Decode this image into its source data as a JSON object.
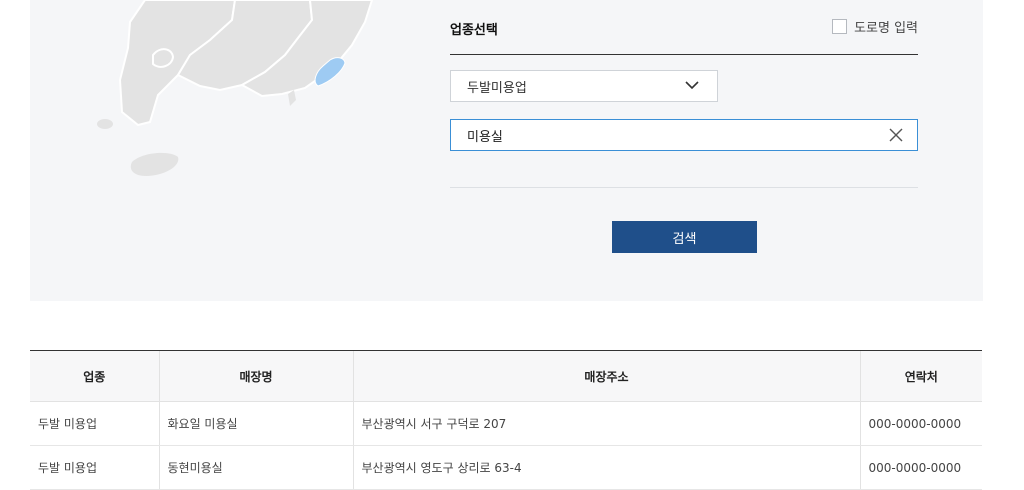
{
  "search": {
    "section_title": "업종선택",
    "road_name_label": "도로명 입력",
    "category_selected": "두발미용업",
    "keyword_value": "미용실",
    "search_button_label": "검색"
  },
  "map": {
    "highlight_color": "#9ecbf3",
    "region_color": "#e3e3e3"
  },
  "table": {
    "headers": [
      "업종",
      "매장명",
      "매장주소",
      "연락처"
    ],
    "rows": [
      [
        "두발 미용업",
        "화요일 미용실",
        "부산광역시 서구 구덕로 207",
        "000-0000-0000"
      ],
      [
        "두발 미용업",
        "동현미용실",
        "부산광역시 영도구 상리로 63-4",
        "000-0000-0000"
      ]
    ]
  }
}
